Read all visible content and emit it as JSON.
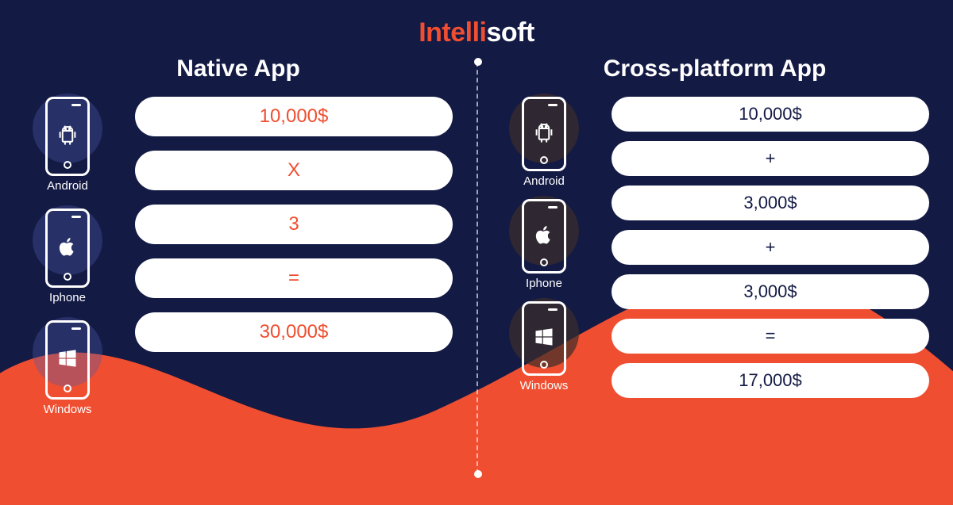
{
  "logo": {
    "accent": "Intelli",
    "rest": "soft"
  },
  "left": {
    "title": "Native App",
    "devices": [
      {
        "label": "Android",
        "icon": "android"
      },
      {
        "label": "Iphone",
        "icon": "apple"
      },
      {
        "label": "Windows",
        "icon": "windows"
      }
    ],
    "pills": [
      "10,000$",
      "X",
      "3",
      "=",
      "30,000$"
    ]
  },
  "right": {
    "title": "Cross-platform App",
    "devices": [
      {
        "label": "Android",
        "icon": "android"
      },
      {
        "label": "Iphone",
        "icon": "apple"
      },
      {
        "label": "Windows",
        "icon": "windows"
      }
    ],
    "pills": [
      "10,000$",
      "+",
      "3,000$",
      "+",
      "3,000$",
      "=",
      "17,000$"
    ]
  }
}
